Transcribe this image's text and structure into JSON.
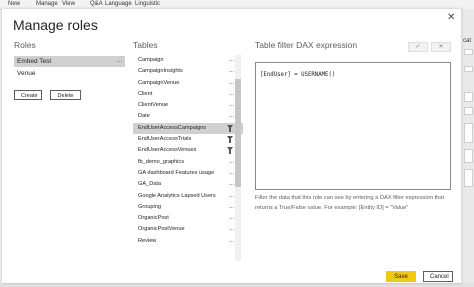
{
  "ribbon": {
    "items": [
      "New",
      "Manage",
      "View",
      "Q&A",
      "Language",
      "Linguistic"
    ]
  },
  "background": {
    "right_label": "cat"
  },
  "dialog": {
    "title": "Manage roles",
    "close_icon": "close-icon"
  },
  "roles": {
    "heading": "Roles",
    "items": [
      {
        "label": "Embed Test",
        "selected": true,
        "more": "..."
      },
      {
        "label": "Venue",
        "selected": false,
        "more": ""
      }
    ],
    "create_label": "Create",
    "delete_label": "Delete"
  },
  "tables": {
    "heading": "Tables",
    "items": [
      {
        "label": "Campaign",
        "more": "...",
        "filter": false,
        "selected": false
      },
      {
        "label": "CampaignInsights",
        "more": "...",
        "filter": false,
        "selected": false
      },
      {
        "label": "CampaignVenue",
        "more": "...",
        "filter": false,
        "selected": false
      },
      {
        "label": "Client",
        "more": "...",
        "filter": false,
        "selected": false
      },
      {
        "label": "ClientVenue",
        "more": "...",
        "filter": false,
        "selected": false
      },
      {
        "label": "Date",
        "more": "...",
        "filter": false,
        "selected": false
      },
      {
        "label": "EndUserAccessCampaigns",
        "more": "",
        "filter": true,
        "selected": true
      },
      {
        "label": "EndUserAccessTrials",
        "more": "",
        "filter": true,
        "selected": false
      },
      {
        "label": "EndUserAccessVenues",
        "more": "",
        "filter": true,
        "selected": false
      },
      {
        "label": "fb_demo_graphics",
        "more": "...",
        "filter": false,
        "selected": false
      },
      {
        "label": "GA dashboard Features usage",
        "more": "...",
        "filter": false,
        "selected": false
      },
      {
        "label": "GA_Data",
        "more": "...",
        "filter": false,
        "selected": false
      },
      {
        "label": "Google Analytics Lapsed Users",
        "more": "...",
        "filter": false,
        "selected": false
      },
      {
        "label": "Grouping",
        "more": "...",
        "filter": false,
        "selected": false
      },
      {
        "label": "OrganicPost",
        "more": "...",
        "filter": false,
        "selected": false
      },
      {
        "label": "OrganicPostVenue",
        "more": "...",
        "filter": false,
        "selected": false
      },
      {
        "label": "Review",
        "more": "...",
        "filter": false,
        "selected": false
      }
    ]
  },
  "dax": {
    "heading": "Table filter DAX expression",
    "check_label": "✓",
    "cancel_label": "✕",
    "expression": "[EndUser] = USERNAME()",
    "help": "Filter the data that this role can see by entering a DAX filter expression that returns a True/False value. For example: [Entity ID] = \"Value\""
  },
  "footer": {
    "save_label": "Save",
    "cancel_label": "Cancel"
  },
  "colors": {
    "accent": "#f2c811",
    "selected_bg": "#d2d0ce"
  }
}
